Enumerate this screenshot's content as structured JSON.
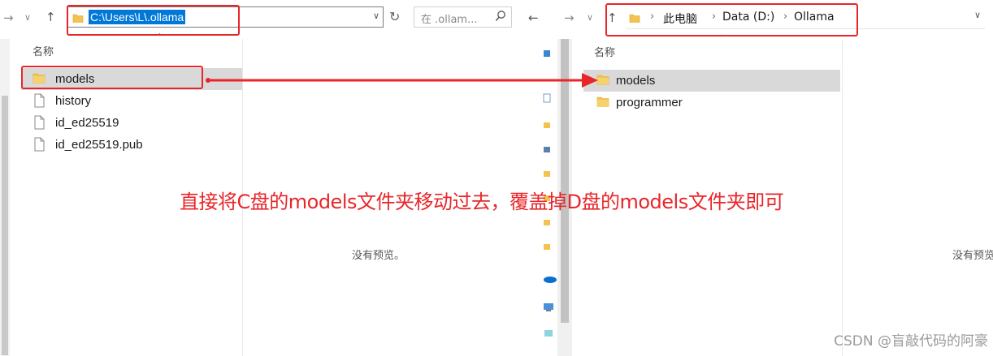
{
  "left_window": {
    "address_path": "C:\\Users\\L\\.ollama",
    "search_placeholder": "在 .ollam...",
    "column_name": "名称",
    "files": [
      {
        "name": "models",
        "type": "folder",
        "selected": true
      },
      {
        "name": "history",
        "type": "file",
        "selected": false
      },
      {
        "name": "id_ed25519",
        "type": "file",
        "selected": false
      },
      {
        "name": "id_ed25519.pub",
        "type": "file",
        "selected": false
      }
    ],
    "preview_message": "没有预览。"
  },
  "right_window": {
    "breadcrumb": [
      "此电脑",
      "Data (D:)",
      "Ollama"
    ],
    "column_name": "名称",
    "files": [
      {
        "name": "models",
        "type": "folder",
        "selected": true
      },
      {
        "name": "programmer",
        "type": "folder",
        "selected": false
      }
    ],
    "preview_message": "没有预览。"
  },
  "annotation": {
    "instruction": "直接将C盘的models文件夹移动过去，覆盖掉D盘的models文件夹即可",
    "color": "#e8262a"
  },
  "watermark": "CSDN @盲敲代码的阿豪",
  "colors": {
    "selection": "#d9d9d9",
    "address_highlight": "#0078d7",
    "folder": "#f4c34f"
  }
}
